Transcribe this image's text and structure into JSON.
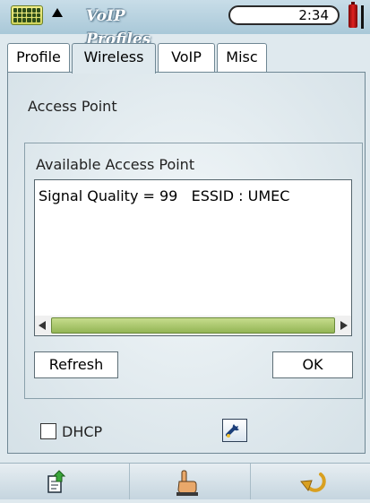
{
  "statusbar": {
    "app_title": "VoIP Profiles",
    "time": "2:34",
    "icons": [
      "keyboard-icon",
      "menu-arrow-icon",
      "battery-icon",
      "signal-icon"
    ]
  },
  "tabs": [
    {
      "label": "Profile",
      "active": false
    },
    {
      "label": "Wireless",
      "active": true
    },
    {
      "label": "VoIP",
      "active": false
    },
    {
      "label": "Misc",
      "active": false
    }
  ],
  "wireless": {
    "heading": "Access Point",
    "available_title": "Available Access Point",
    "access_points": [
      "Signal Quality = 99   ESSID : UMEC"
    ],
    "refresh_label": "Refresh",
    "ok_label": "OK",
    "dhcp_label": "DHCP",
    "dhcp_checked": false
  },
  "bottombar": {
    "icons": [
      "export-icon",
      "hand-pointer-icon",
      "back-arrow-icon"
    ]
  },
  "colors": {
    "scroll_thumb": "#a8c56a",
    "panel_bg": "#dfe9ee"
  }
}
